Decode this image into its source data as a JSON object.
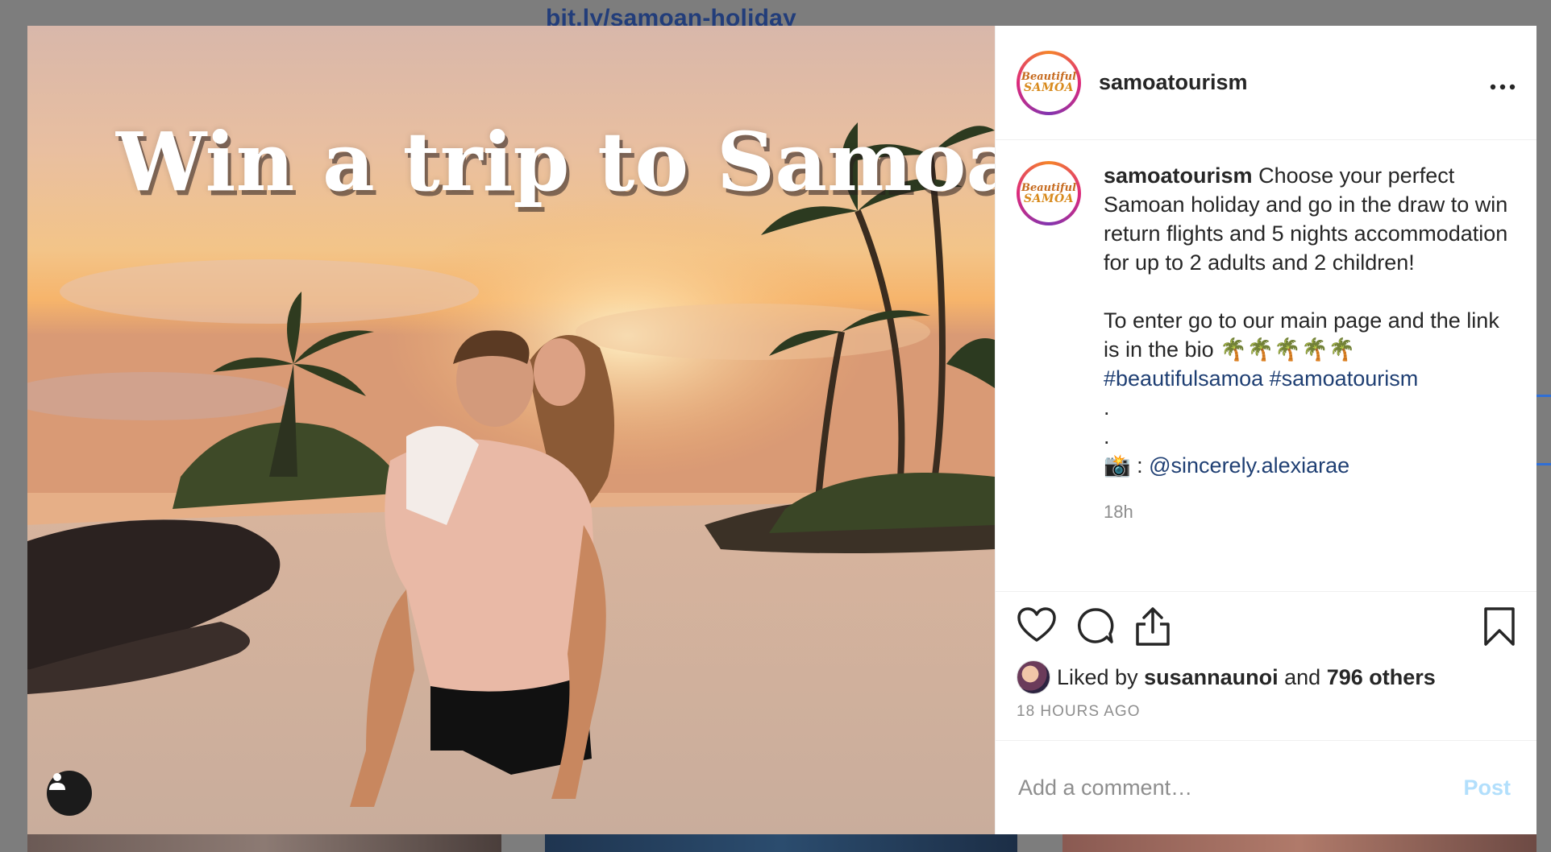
{
  "background": {
    "link_text": "bit.ly/samoan-holiday"
  },
  "post": {
    "image_overlay_text": "Win a trip to Samoa!",
    "user_badge_icon": "user-icon"
  },
  "header": {
    "avatar_text_line1": "Beautiful",
    "avatar_text_line2": "SAMOA",
    "username": "samoatourism",
    "more_icon": "more-horizontal-icon"
  },
  "caption": {
    "username": "samoatourism",
    "text": "Choose your perfect Samoan holiday and go in the draw to win return flights and 5 nights accommodation for up to 2 adults and 2 children!",
    "para2": "To enter go to our main page and the link is in the bio 🌴🌴🌴🌴🌴",
    "hashtags": "#beautifulsamoa #samoatourism",
    "dot1": ".",
    "dot2": ".",
    "camera_emoji": "📸 : ",
    "mention": "@sincerely.alexiarae",
    "time": "18h"
  },
  "actions": {
    "like_icon": "heart-icon",
    "comment_icon": "comment-icon",
    "share_icon": "share-icon",
    "save_icon": "bookmark-icon"
  },
  "likes": {
    "prefix": "Liked by",
    "user": "susannaunoi",
    "and": "and",
    "others": "796 others"
  },
  "timestamp": "18 HOURS AGO",
  "comment": {
    "placeholder": "Add a comment…",
    "post_label": "Post",
    "post_color": "#b2dffc"
  }
}
